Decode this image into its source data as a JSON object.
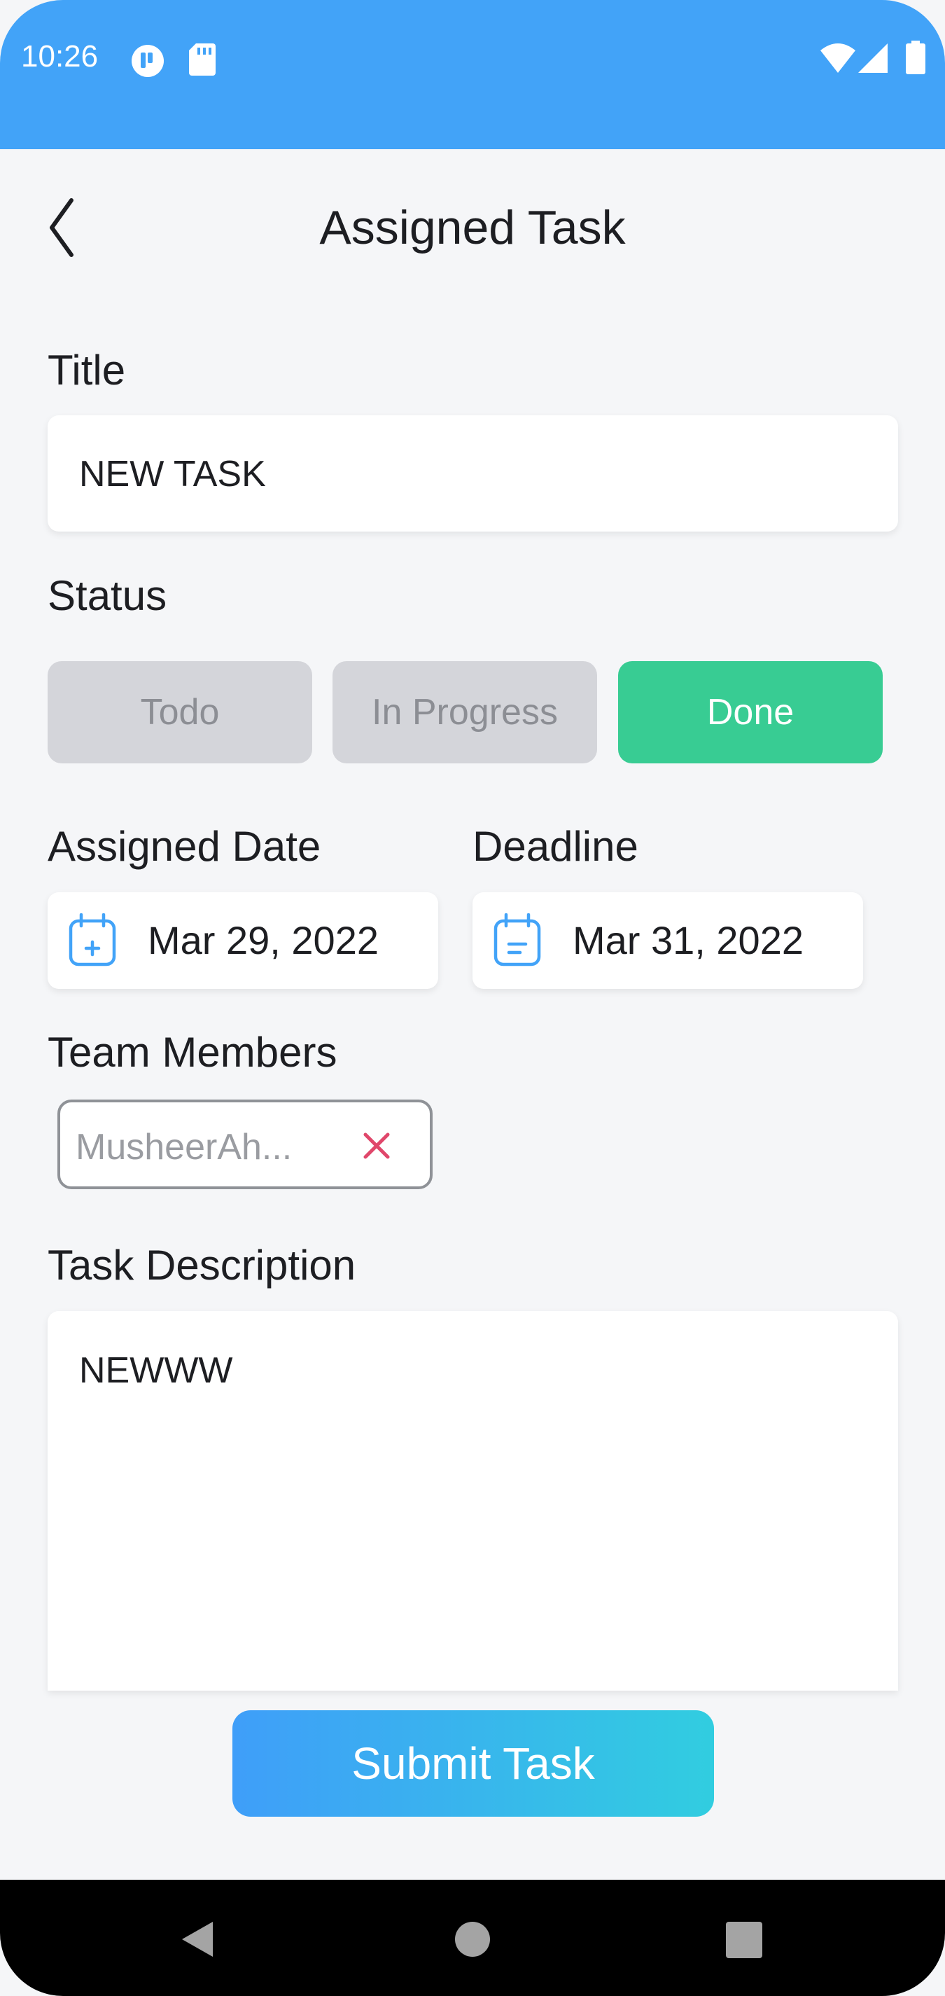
{
  "status_bar": {
    "time": "10:26",
    "icons": [
      "app-notification-icon",
      "sd-card-icon",
      "wifi-icon",
      "signal-icon",
      "battery-icon"
    ],
    "background": "#42a3f8"
  },
  "header": {
    "title": "Assigned Task",
    "back_icon": "chevron-left-icon"
  },
  "form": {
    "title_label": "Title",
    "title_value": "NEW TASK",
    "status_label": "Status",
    "status_options": [
      "Todo",
      "In Progress",
      "Done"
    ],
    "status_selected": "Done",
    "assigned_date_label": "Assigned Date",
    "assigned_date_value": "Mar 29, 2022",
    "deadline_label": "Deadline",
    "deadline_value": "Mar 31, 2022",
    "team_members_label": "Team Members",
    "team_members": [
      "MusheerAh..."
    ],
    "description_label": "Task Description",
    "description_value": "NEWWW"
  },
  "actions": {
    "submit_label": "Submit Task"
  },
  "colors": {
    "accent": "#42a3f8",
    "done_green": "#38cc93",
    "remove_red": "#e0476b",
    "submit_gradient": [
      "#3f9ef9",
      "#31cde0"
    ]
  },
  "nav_bar": {
    "icons": [
      "nav-back-icon",
      "nav-home-icon",
      "nav-recents-icon"
    ]
  }
}
